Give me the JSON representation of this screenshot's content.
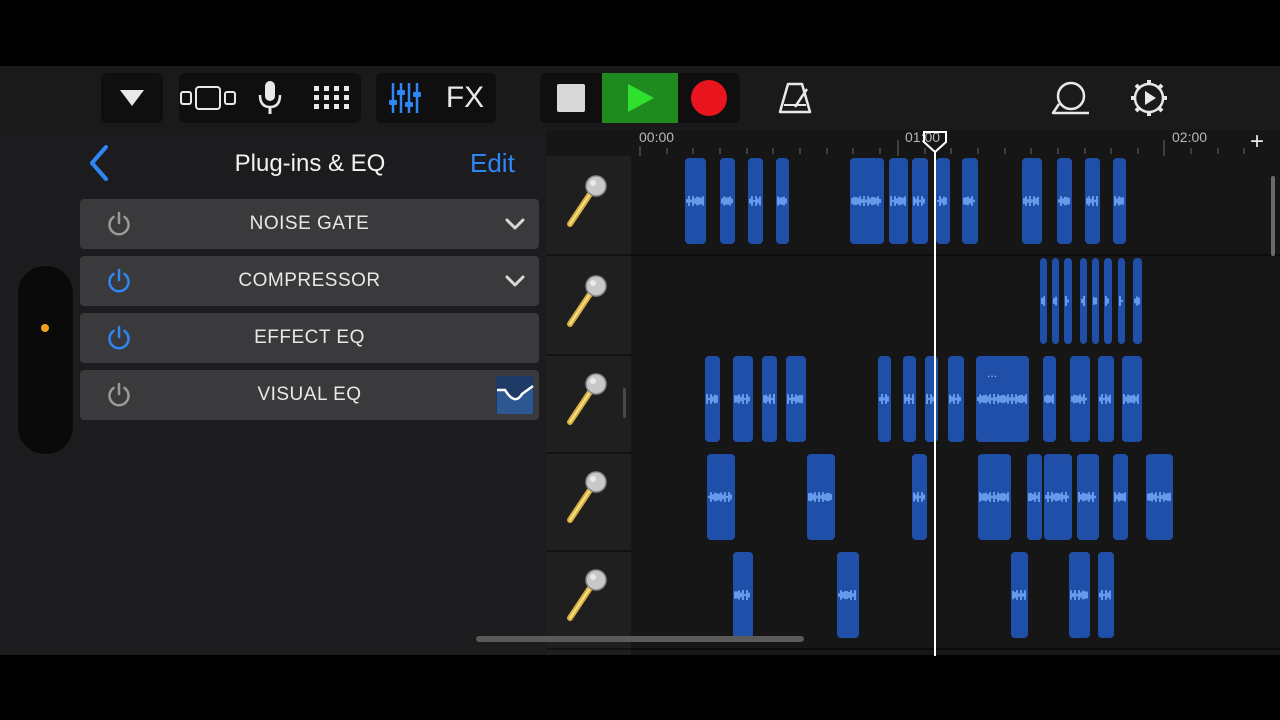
{
  "toolbar": {
    "fx_label": "FX",
    "icons": [
      "browser-dropdown-icon",
      "tracks-view-icon",
      "microphone-icon",
      "grid-icon",
      "mixer-icon",
      "stop-icon",
      "play-icon",
      "record-icon",
      "metronome-icon",
      "loop-browser-icon",
      "settings-icon"
    ],
    "colors": {
      "play": "#1f8a1f",
      "record": "#e8141e",
      "accent": "#2f87f5"
    }
  },
  "panel": {
    "title": "Plug-ins & EQ",
    "edit_label": "Edit",
    "plugins": [
      {
        "label": "NOISE GATE",
        "enabled": false,
        "expandable": true
      },
      {
        "label": "COMPRESSOR",
        "enabled": true,
        "expandable": true
      },
      {
        "label": "EFFECT EQ",
        "enabled": true,
        "expandable": false
      },
      {
        "label": "VISUAL EQ",
        "enabled": false,
        "expandable": false
      }
    ]
  },
  "ruler": {
    "labels": [
      "00:00",
      "01:00",
      "02:00"
    ],
    "add_label": "+"
  },
  "tracks": [
    {
      "instrument": "microphone"
    },
    {
      "instrument": "microphone"
    },
    {
      "instrument": "microphone"
    },
    {
      "instrument": "microphone"
    },
    {
      "instrument": "microphone"
    }
  ],
  "region_label": "..."
}
